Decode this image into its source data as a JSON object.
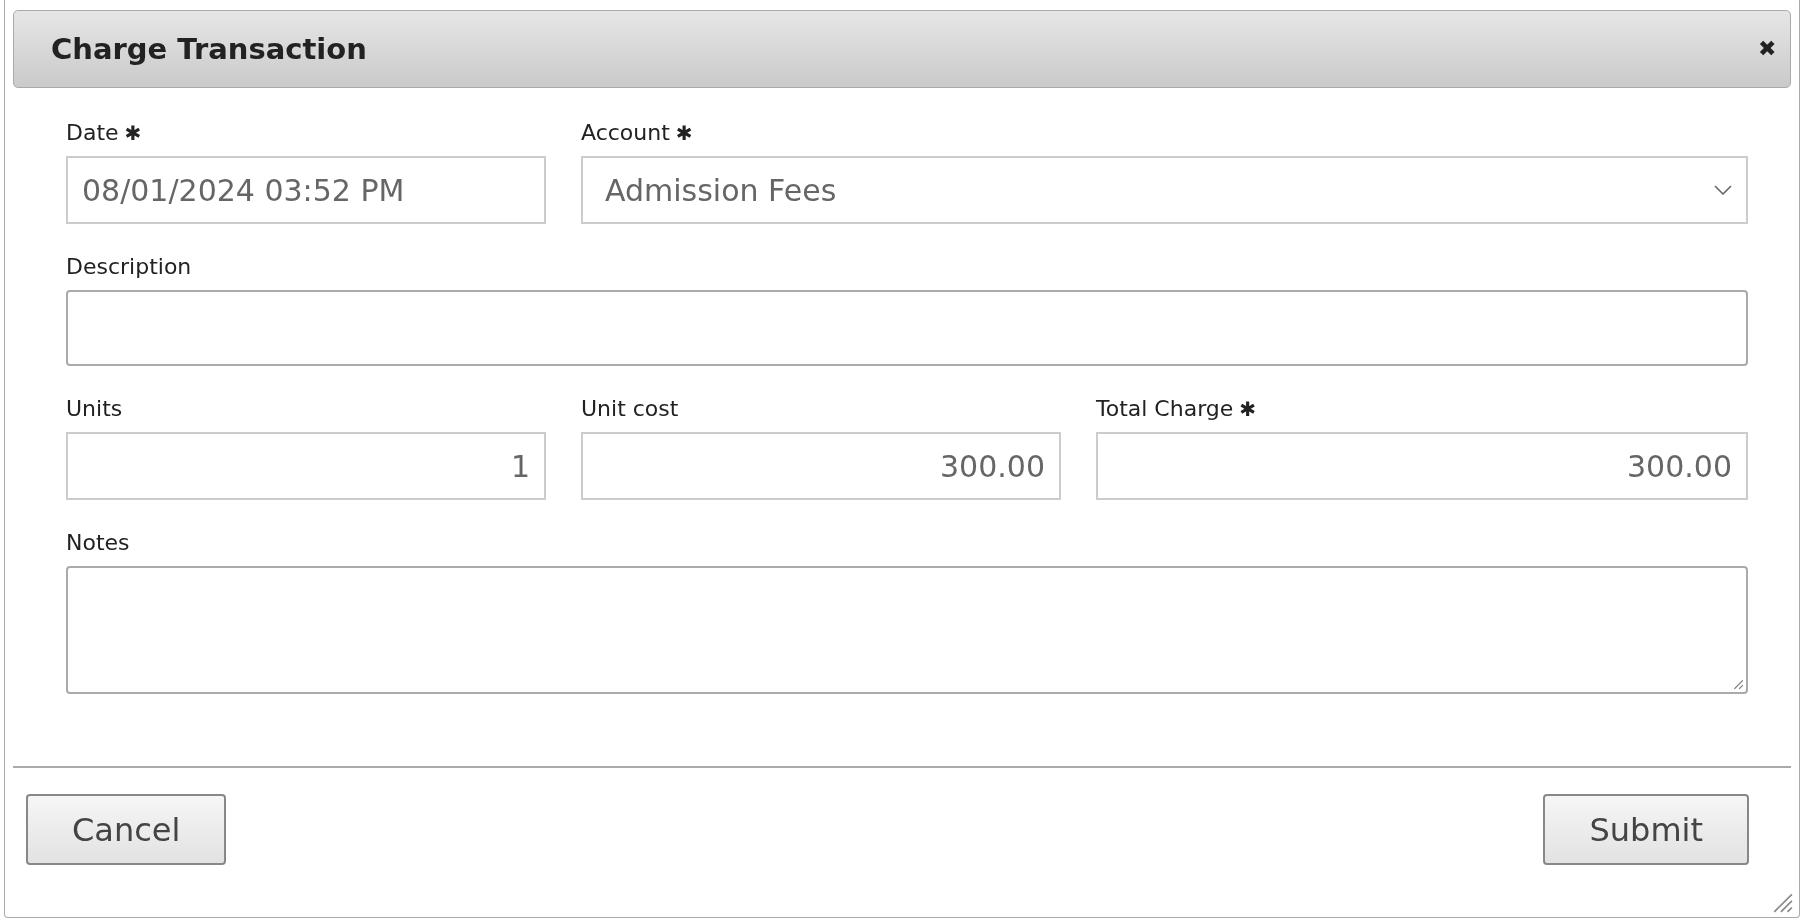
{
  "dialog": {
    "title": "Charge Transaction",
    "close": "✖"
  },
  "fields": [
    {
      "kind": "date",
      "label": "Date",
      "required": true,
      "value": "08/01/2024 03:52 PM"
    },
    {
      "kind": "select",
      "label": "Account",
      "required": true,
      "value": "Admission Fees"
    },
    {
      "kind": "text",
      "label": "Description",
      "required": false
    },
    {
      "kind": "number",
      "label": "Units",
      "required": false,
      "value": "1"
    },
    {
      "kind": "number",
      "label": "Unit cost",
      "required": false,
      "value": "300.00"
    },
    {
      "kind": "number",
      "label": "Total Charge",
      "required": true,
      "value": "300.00"
    },
    {
      "kind": "textarea",
      "label": "Notes",
      "required": false
    }
  ],
  "required_mark": "✱",
  "buttons": [
    {
      "label": "Cancel"
    },
    {
      "label": "Submit"
    }
  ]
}
